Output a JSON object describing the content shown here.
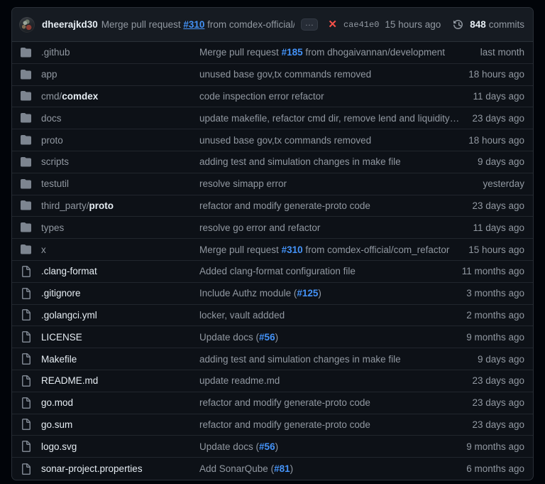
{
  "header": {
    "avatar_alt": "dheerajkd30 avatar",
    "author": "dheerajkd30",
    "message_prefix": "Merge pull request ",
    "pr_ref": "#310",
    "message_suffix": " from comdex-official/com_refactor",
    "ellipsis_label": "...",
    "status_icon": "x-circle-fail-icon",
    "status_glyph": "✕",
    "commit_sha": "cae41e0",
    "commit_time": "15 hours ago",
    "commits_count": "848",
    "commits_label": "commits",
    "colors": {
      "fail_red": "#f85149",
      "link_blue": "#4493f8",
      "bright_text": "#e6edf3",
      "muted_text": "#9198a1",
      "header_bg": "#161b22",
      "row_bg": "#0d1117",
      "border": "#21262d",
      "icon_gray": "#7d8590"
    }
  },
  "rows": [
    {
      "type": "dir",
      "icon": "folder-icon",
      "name_prefix": "",
      "name": ".github",
      "commit_prefix": "Merge pull request ",
      "pr_ref": "#185",
      "commit_suffix": " from dhogaivannan/development",
      "time": "last month"
    },
    {
      "type": "dir",
      "icon": "folder-icon",
      "name_prefix": "",
      "name": "app",
      "commit_prefix": "unused base gov,tx commands removed",
      "pr_ref": "",
      "commit_suffix": "",
      "time": "18 hours ago"
    },
    {
      "type": "dir",
      "icon": "folder-icon",
      "name_prefix": "cmd/",
      "name": "comdex",
      "commit_prefix": "code inspection error refactor",
      "pr_ref": "",
      "commit_suffix": "",
      "time": "11 days ago"
    },
    {
      "type": "dir",
      "icon": "folder-icon",
      "name_prefix": "",
      "name": "docs",
      "commit_prefix": "update makefile, refactor cmd dir, remove lend and liquidity changes ...",
      "pr_ref": "",
      "commit_suffix": "",
      "time": "23 days ago"
    },
    {
      "type": "dir",
      "icon": "folder-icon",
      "name_prefix": "",
      "name": "proto",
      "commit_prefix": "unused base gov,tx commands removed",
      "pr_ref": "",
      "commit_suffix": "",
      "time": "18 hours ago"
    },
    {
      "type": "dir",
      "icon": "folder-icon",
      "name_prefix": "",
      "name": "scripts",
      "commit_prefix": "adding test and simulation changes in make file",
      "pr_ref": "",
      "commit_suffix": "",
      "time": "9 days ago"
    },
    {
      "type": "dir",
      "icon": "folder-icon",
      "name_prefix": "",
      "name": "testutil",
      "commit_prefix": "resolve simapp error",
      "pr_ref": "",
      "commit_suffix": "",
      "time": "yesterday"
    },
    {
      "type": "dir",
      "icon": "folder-icon",
      "name_prefix": "third_party/",
      "name": "proto",
      "commit_prefix": "refactor and modify generate-proto code",
      "pr_ref": "",
      "commit_suffix": "",
      "time": "23 days ago"
    },
    {
      "type": "dir",
      "icon": "folder-icon",
      "name_prefix": "",
      "name": "types",
      "commit_prefix": "resolve go error and refactor",
      "pr_ref": "",
      "commit_suffix": "",
      "time": "11 days ago"
    },
    {
      "type": "dir",
      "icon": "folder-icon",
      "name_prefix": "",
      "name": "x",
      "commit_prefix": "Merge pull request ",
      "pr_ref": "#310",
      "commit_suffix": " from comdex-official/com_refactor",
      "time": "15 hours ago"
    },
    {
      "type": "file",
      "icon": "file-icon",
      "name_prefix": "",
      "name": ".clang-format",
      "commit_prefix": "Added clang-format configuration file",
      "pr_ref": "",
      "commit_suffix": "",
      "time": "11 months ago"
    },
    {
      "type": "file",
      "icon": "file-icon",
      "name_prefix": "",
      "name": ".gitignore",
      "commit_prefix": "Include Authz module (",
      "pr_ref": "#125",
      "commit_suffix": ")",
      "time": "3 months ago"
    },
    {
      "type": "file",
      "icon": "file-icon",
      "name_prefix": "",
      "name": ".golangci.yml",
      "commit_prefix": "locker, vault addded",
      "pr_ref": "",
      "commit_suffix": "",
      "time": "2 months ago"
    },
    {
      "type": "file",
      "icon": "file-icon",
      "name_prefix": "",
      "name": "LICENSE",
      "commit_prefix": "Update docs (",
      "pr_ref": "#56",
      "commit_suffix": ")",
      "time": "9 months ago"
    },
    {
      "type": "file",
      "icon": "file-icon",
      "name_prefix": "",
      "name": "Makefile",
      "commit_prefix": "adding test and simulation changes in make file",
      "pr_ref": "",
      "commit_suffix": "",
      "time": "9 days ago"
    },
    {
      "type": "file",
      "icon": "file-icon",
      "name_prefix": "",
      "name": "README.md",
      "commit_prefix": "update readme.md",
      "pr_ref": "",
      "commit_suffix": "",
      "time": "23 days ago"
    },
    {
      "type": "file",
      "icon": "file-icon",
      "name_prefix": "",
      "name": "go.mod",
      "commit_prefix": "refactor and modify generate-proto code",
      "pr_ref": "",
      "commit_suffix": "",
      "time": "23 days ago"
    },
    {
      "type": "file",
      "icon": "file-icon",
      "name_prefix": "",
      "name": "go.sum",
      "commit_prefix": "refactor and modify generate-proto code",
      "pr_ref": "",
      "commit_suffix": "",
      "time": "23 days ago"
    },
    {
      "type": "file",
      "icon": "file-icon",
      "name_prefix": "",
      "name": "logo.svg",
      "commit_prefix": "Update docs (",
      "pr_ref": "#56",
      "commit_suffix": ")",
      "time": "9 months ago"
    },
    {
      "type": "file",
      "icon": "file-icon",
      "name_prefix": "",
      "name": "sonar-project.properties",
      "commit_prefix": "Add SonarQube (",
      "pr_ref": "#81",
      "commit_suffix": ")",
      "time": "6 months ago"
    }
  ]
}
